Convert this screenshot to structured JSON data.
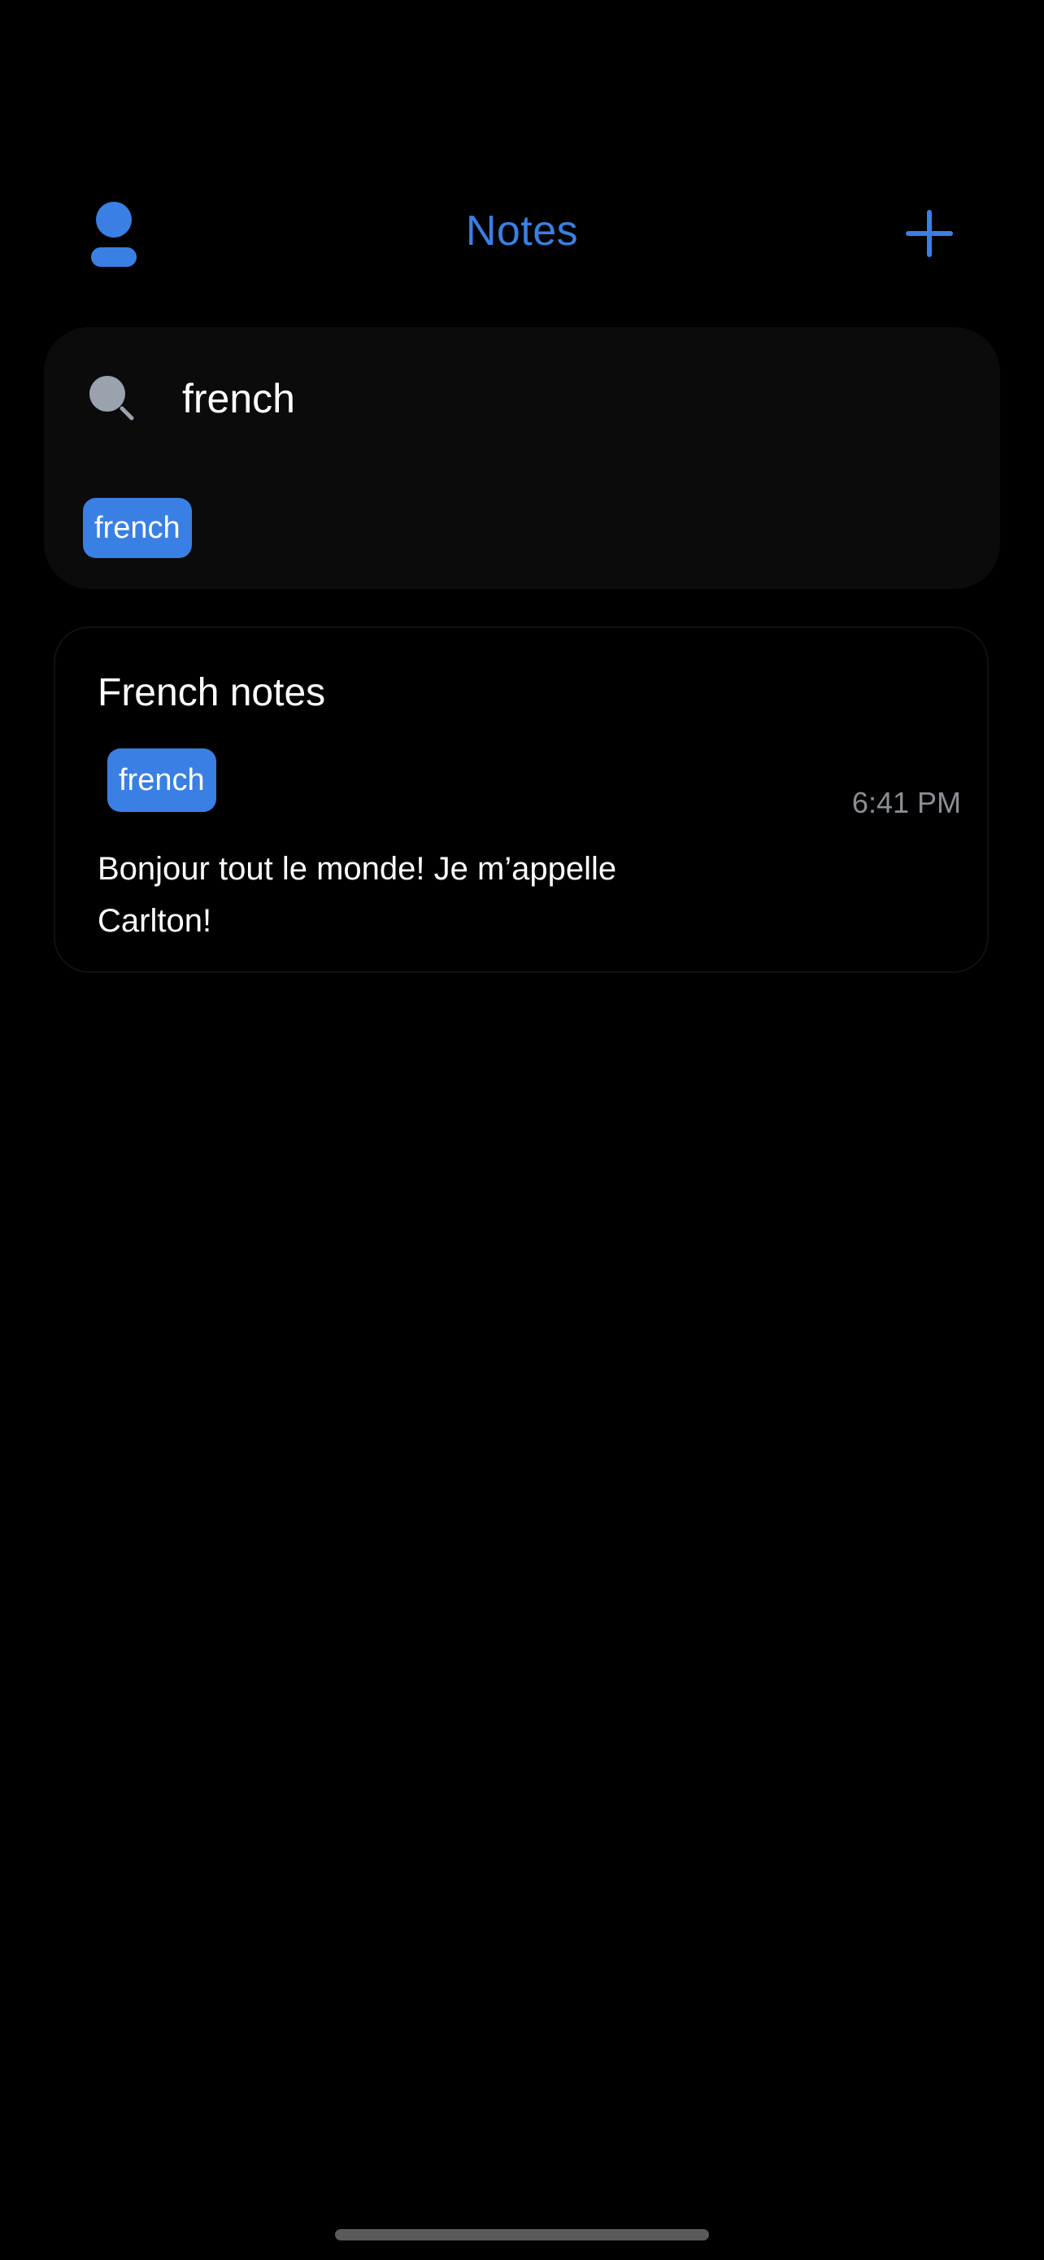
{
  "header": {
    "title": "Notes",
    "accent_color": "#3a7fe3",
    "profile_icon": "person-icon",
    "add_icon": "plus-icon"
  },
  "search": {
    "icon": "search-icon",
    "value": "french",
    "selected_tags": [
      {
        "label": "french"
      }
    ]
  },
  "notes": [
    {
      "title": "French notes",
      "tags": [
        {
          "label": "french"
        }
      ],
      "time": "6:41 PM",
      "body": "Bonjour tout le monde! Je m’appelle Carlton!"
    }
  ],
  "colors": {
    "background": "#000000",
    "tag_background": "#3a7fe3",
    "panel_background": "#0b0b0b",
    "muted_text": "#8a8e96"
  }
}
